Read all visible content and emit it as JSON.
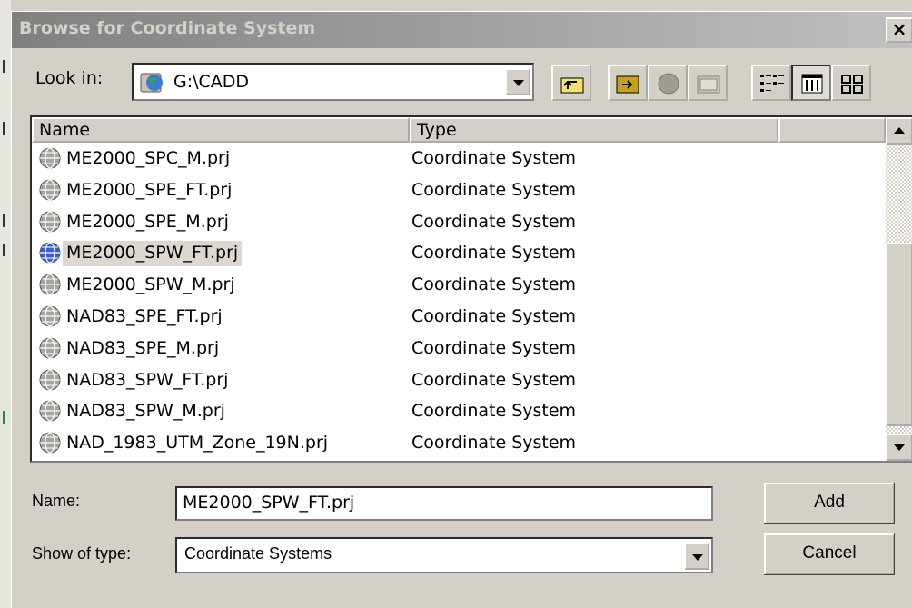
{
  "dialog": {
    "title": "Browse for Coordinate System",
    "close_label": "×"
  },
  "lookin": {
    "label": "Look in:",
    "value": "G:\\CADD"
  },
  "columns": [
    "Name",
    "Type",
    ""
  ],
  "files": [
    {
      "name": "ME2000_SPC_M.prj",
      "type": "Coordinate System",
      "selected": false
    },
    {
      "name": "ME2000_SPE_FT.prj",
      "type": "Coordinate System",
      "selected": false
    },
    {
      "name": "ME2000_SPE_M.prj",
      "type": "Coordinate System",
      "selected": false
    },
    {
      "name": "ME2000_SPW_FT.prj",
      "type": "Coordinate System",
      "selected": true
    },
    {
      "name": "ME2000_SPW_M.prj",
      "type": "Coordinate System",
      "selected": false
    },
    {
      "name": "NAD83_SPE_FT.prj",
      "type": "Coordinate System",
      "selected": false
    },
    {
      "name": "NAD83_SPE_M.prj",
      "type": "Coordinate System",
      "selected": false
    },
    {
      "name": "NAD83_SPW_FT.prj",
      "type": "Coordinate System",
      "selected": false
    },
    {
      "name": "NAD83_SPW_M.prj",
      "type": "Coordinate System",
      "selected": false
    },
    {
      "name": "NAD_1983_UTM_Zone_19N.prj",
      "type": "Coordinate System",
      "selected": false
    }
  ],
  "form": {
    "name_label": "Name:",
    "name_value": "ME2000_SPW_FT.prj",
    "type_label": "Show of type:",
    "type_value": "Coordinate Systems"
  },
  "buttons": {
    "add": "Add",
    "cancel": "Cancel"
  },
  "toolbar_icons": [
    "up-one-level-icon",
    "connect-folder-icon",
    "disconnect-icon",
    "properties-icon",
    "list-view-icon",
    "details-view-icon",
    "thumbnails-view-icon"
  ]
}
